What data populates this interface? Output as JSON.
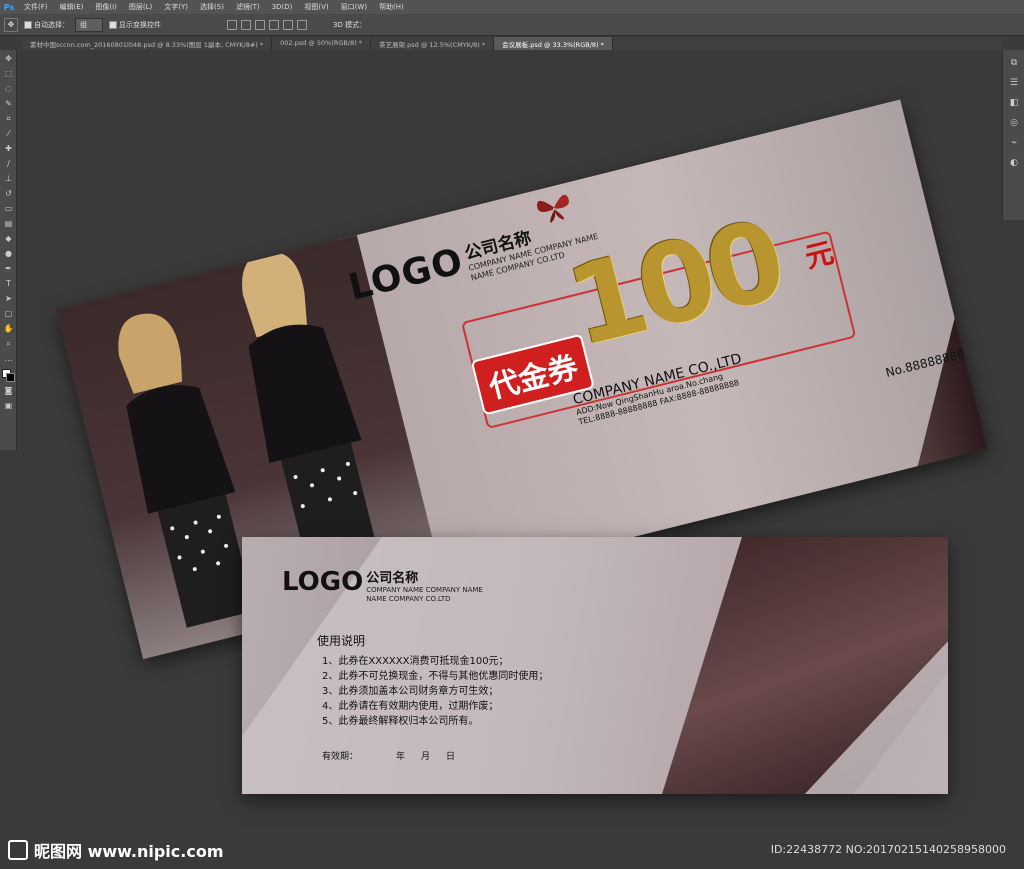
{
  "menubar": {
    "app_logo": "Ps",
    "items": [
      "文件(F)",
      "编辑(E)",
      "图像(I)",
      "图层(L)",
      "文字(Y)",
      "选择(S)",
      "滤镜(T)",
      "3D(D)",
      "视图(V)",
      "窗口(W)",
      "帮助(H)"
    ]
  },
  "options": {
    "auto_select_label": "自动选择：",
    "auto_select_value": "组",
    "show_transform_label": "显示变换控件",
    "mode3d_label": "3D 模式："
  },
  "tabs": [
    {
      "label": "素材中国sccnn.com_20160801l048.psd @ 8.33%(图层 1副本, CMYK/8#) *",
      "active": false
    },
    {
      "label": "002.psd @ 50%(RGB/8) *",
      "active": false
    },
    {
      "label": "茶艺展架.psd @ 12.5%(CMYK/8) *",
      "active": false
    },
    {
      "label": "会议展板.psd @ 33.3%(RGB/8) *",
      "active": true
    }
  ],
  "front": {
    "logo": "LOGO",
    "company_cn": "公司名称",
    "company_en_1": "COMPANY NAME COMPANY NAME",
    "company_en_2": "NAME COMPANY CO.LTD",
    "amount": "100",
    "currency": "元",
    "tag": "代金券",
    "company_bottom": "COMPANY NAME CO.,LTD",
    "address": "ADD:Now QingShanHu aroa.No.chang",
    "tel": "TEL:8888-88888888   FAX:8888-88888888",
    "serial": "No.88888888"
  },
  "back": {
    "logo": "LOGO",
    "company_cn": "公司名称",
    "company_en_1": "COMPANY NAME COMPANY NAME",
    "company_en_2": "NAME COMPANY CO.LTD",
    "usage_title": "使用说明",
    "rules": [
      "1、此券在XXXXXX消费可抵现金100元；",
      "2、此券不可兑换现金，不得与其他优惠同时使用；",
      "3、此券须加盖本公司财务章方可生效；",
      "4、此券请在有效期内使用，过期作废；",
      "5、此券最终解释权归本公司所有。"
    ],
    "validity_label": "有效期：",
    "year": "年",
    "month": "月",
    "day": "日"
  },
  "watermark": {
    "site": "昵图网 www.nipic.com",
    "id": "ID:22438772 NO:20170215140258958000"
  }
}
